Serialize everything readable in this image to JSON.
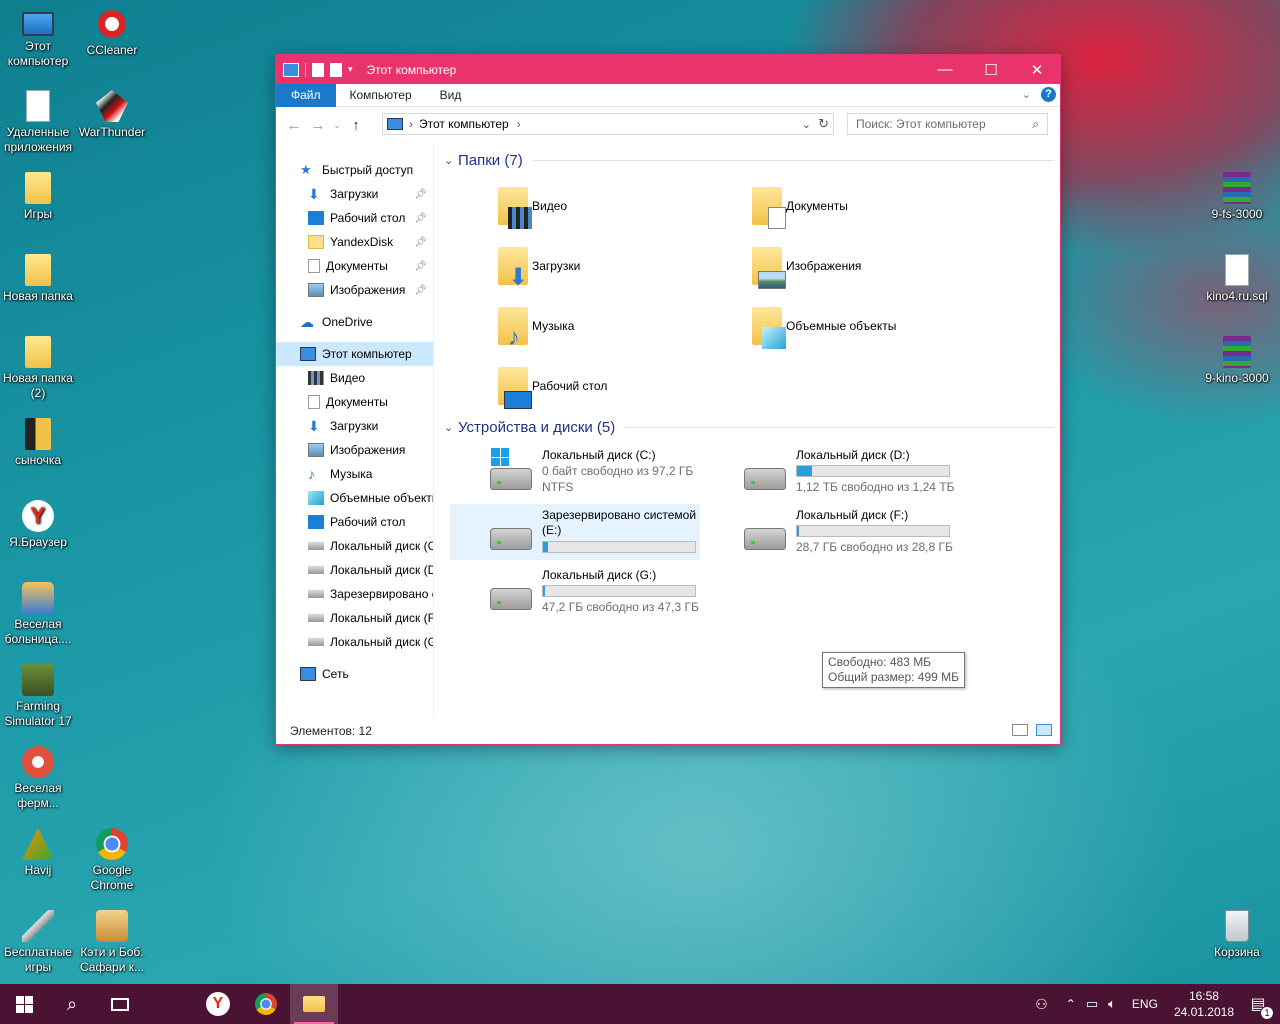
{
  "desktop": {
    "icons_left": [
      {
        "label": "Этот компьютер"
      },
      {
        "label": "CCleaner"
      },
      {
        "label": "Удаленные приложения"
      },
      {
        "label": "WarThunder"
      },
      {
        "label": "Игры"
      },
      {
        "label": "Новая папка"
      },
      {
        "label": "Новая папка (2)"
      },
      {
        "label": "сыночка"
      },
      {
        "label": "Я.Браузер"
      },
      {
        "label": "Веселая больница...."
      },
      {
        "label": "Farming Simulator 17"
      },
      {
        "label": "Веселая ферм..."
      },
      {
        "label": "Havij"
      },
      {
        "label": "Google Chrome"
      },
      {
        "label": "Бесплатные игры"
      },
      {
        "label": "Кэти и Боб. Сафари к..."
      }
    ],
    "icons_right": [
      {
        "label": "9-fs-3000"
      },
      {
        "label": "kino4.ru.sql"
      },
      {
        "label": "9-kino-3000"
      },
      {
        "label": "Корзина"
      }
    ]
  },
  "window": {
    "title": "Этот компьютер",
    "ribbon_tabs": [
      "Файл",
      "Компьютер",
      "Вид"
    ],
    "address": {
      "path_root": "Этот компьютер",
      "separator": "›"
    },
    "search": {
      "placeholder": "Поиск: Этот компьютер"
    },
    "nav": {
      "quick_access": "Быстрый доступ",
      "quick_items": [
        {
          "label": "Загрузки",
          "pinned": true
        },
        {
          "label": "Рабочий стол",
          "pinned": true
        },
        {
          "label": "YandexDisk",
          "pinned": true
        },
        {
          "label": "Документы",
          "pinned": true
        },
        {
          "label": "Изображения",
          "pinned": true
        }
      ],
      "onedrive": "OneDrive",
      "this_pc": "Этот компьютер",
      "pc_items": [
        {
          "label": "Видео"
        },
        {
          "label": "Документы"
        },
        {
          "label": "Загрузки"
        },
        {
          "label": "Изображения"
        },
        {
          "label": "Музыка"
        },
        {
          "label": "Объемные объекты"
        },
        {
          "label": "Рабочий стол"
        },
        {
          "label": "Локальный диск (C"
        },
        {
          "label": "Локальный диск (D"
        },
        {
          "label": "Зарезервировано с"
        },
        {
          "label": "Локальный диск (F"
        },
        {
          "label": "Локальный диск (G"
        }
      ],
      "network": "Сеть"
    },
    "folders_header": "Папки (7)",
    "folders": [
      {
        "label": "Видео",
        "overlay": "film-icon"
      },
      {
        "label": "Документы",
        "overlay": "document-icon"
      },
      {
        "label": "Загрузки",
        "overlay": "download-arrow-icon"
      },
      {
        "label": "Изображения",
        "overlay": "picture-icon"
      },
      {
        "label": "Музыка",
        "overlay": "music-note-icon"
      },
      {
        "label": "Объемные объекты",
        "overlay": "cube-icon"
      },
      {
        "label": "Рабочий стол",
        "overlay": "desktop-icon"
      }
    ],
    "drives_header": "Устройства и диски (5)",
    "drives": [
      {
        "name": "Локальный диск (C:)",
        "line1": "0 байт свободно из 97,2 ГБ",
        "line2": "NTFS",
        "used_fraction": null
      },
      {
        "name": "Локальный диск (D:)",
        "line1": "1,12 ТБ свободно из 1,24 ТБ",
        "used_fraction": 0.097
      },
      {
        "name": "Зарезервировано системой (E:)",
        "line1": "",
        "used_fraction": 0.032
      },
      {
        "name": "Локальный диск (F:)",
        "line1": "28,7 ГБ свободно из 28,8 ГБ",
        "used_fraction": 0.003
      },
      {
        "name": "Локальный диск (G:)",
        "line1": "47,2 ГБ свободно из 47,3 ГБ",
        "used_fraction": 0.002
      }
    ],
    "tooltip": {
      "line1": "Свободно: 483 МБ",
      "line2": "Общий размер: 499 МБ"
    },
    "status": "Элементов: 12"
  },
  "taskbar": {
    "language": "ENG",
    "time": "16:58",
    "date": "24.01.2018",
    "notification_count": "1"
  }
}
